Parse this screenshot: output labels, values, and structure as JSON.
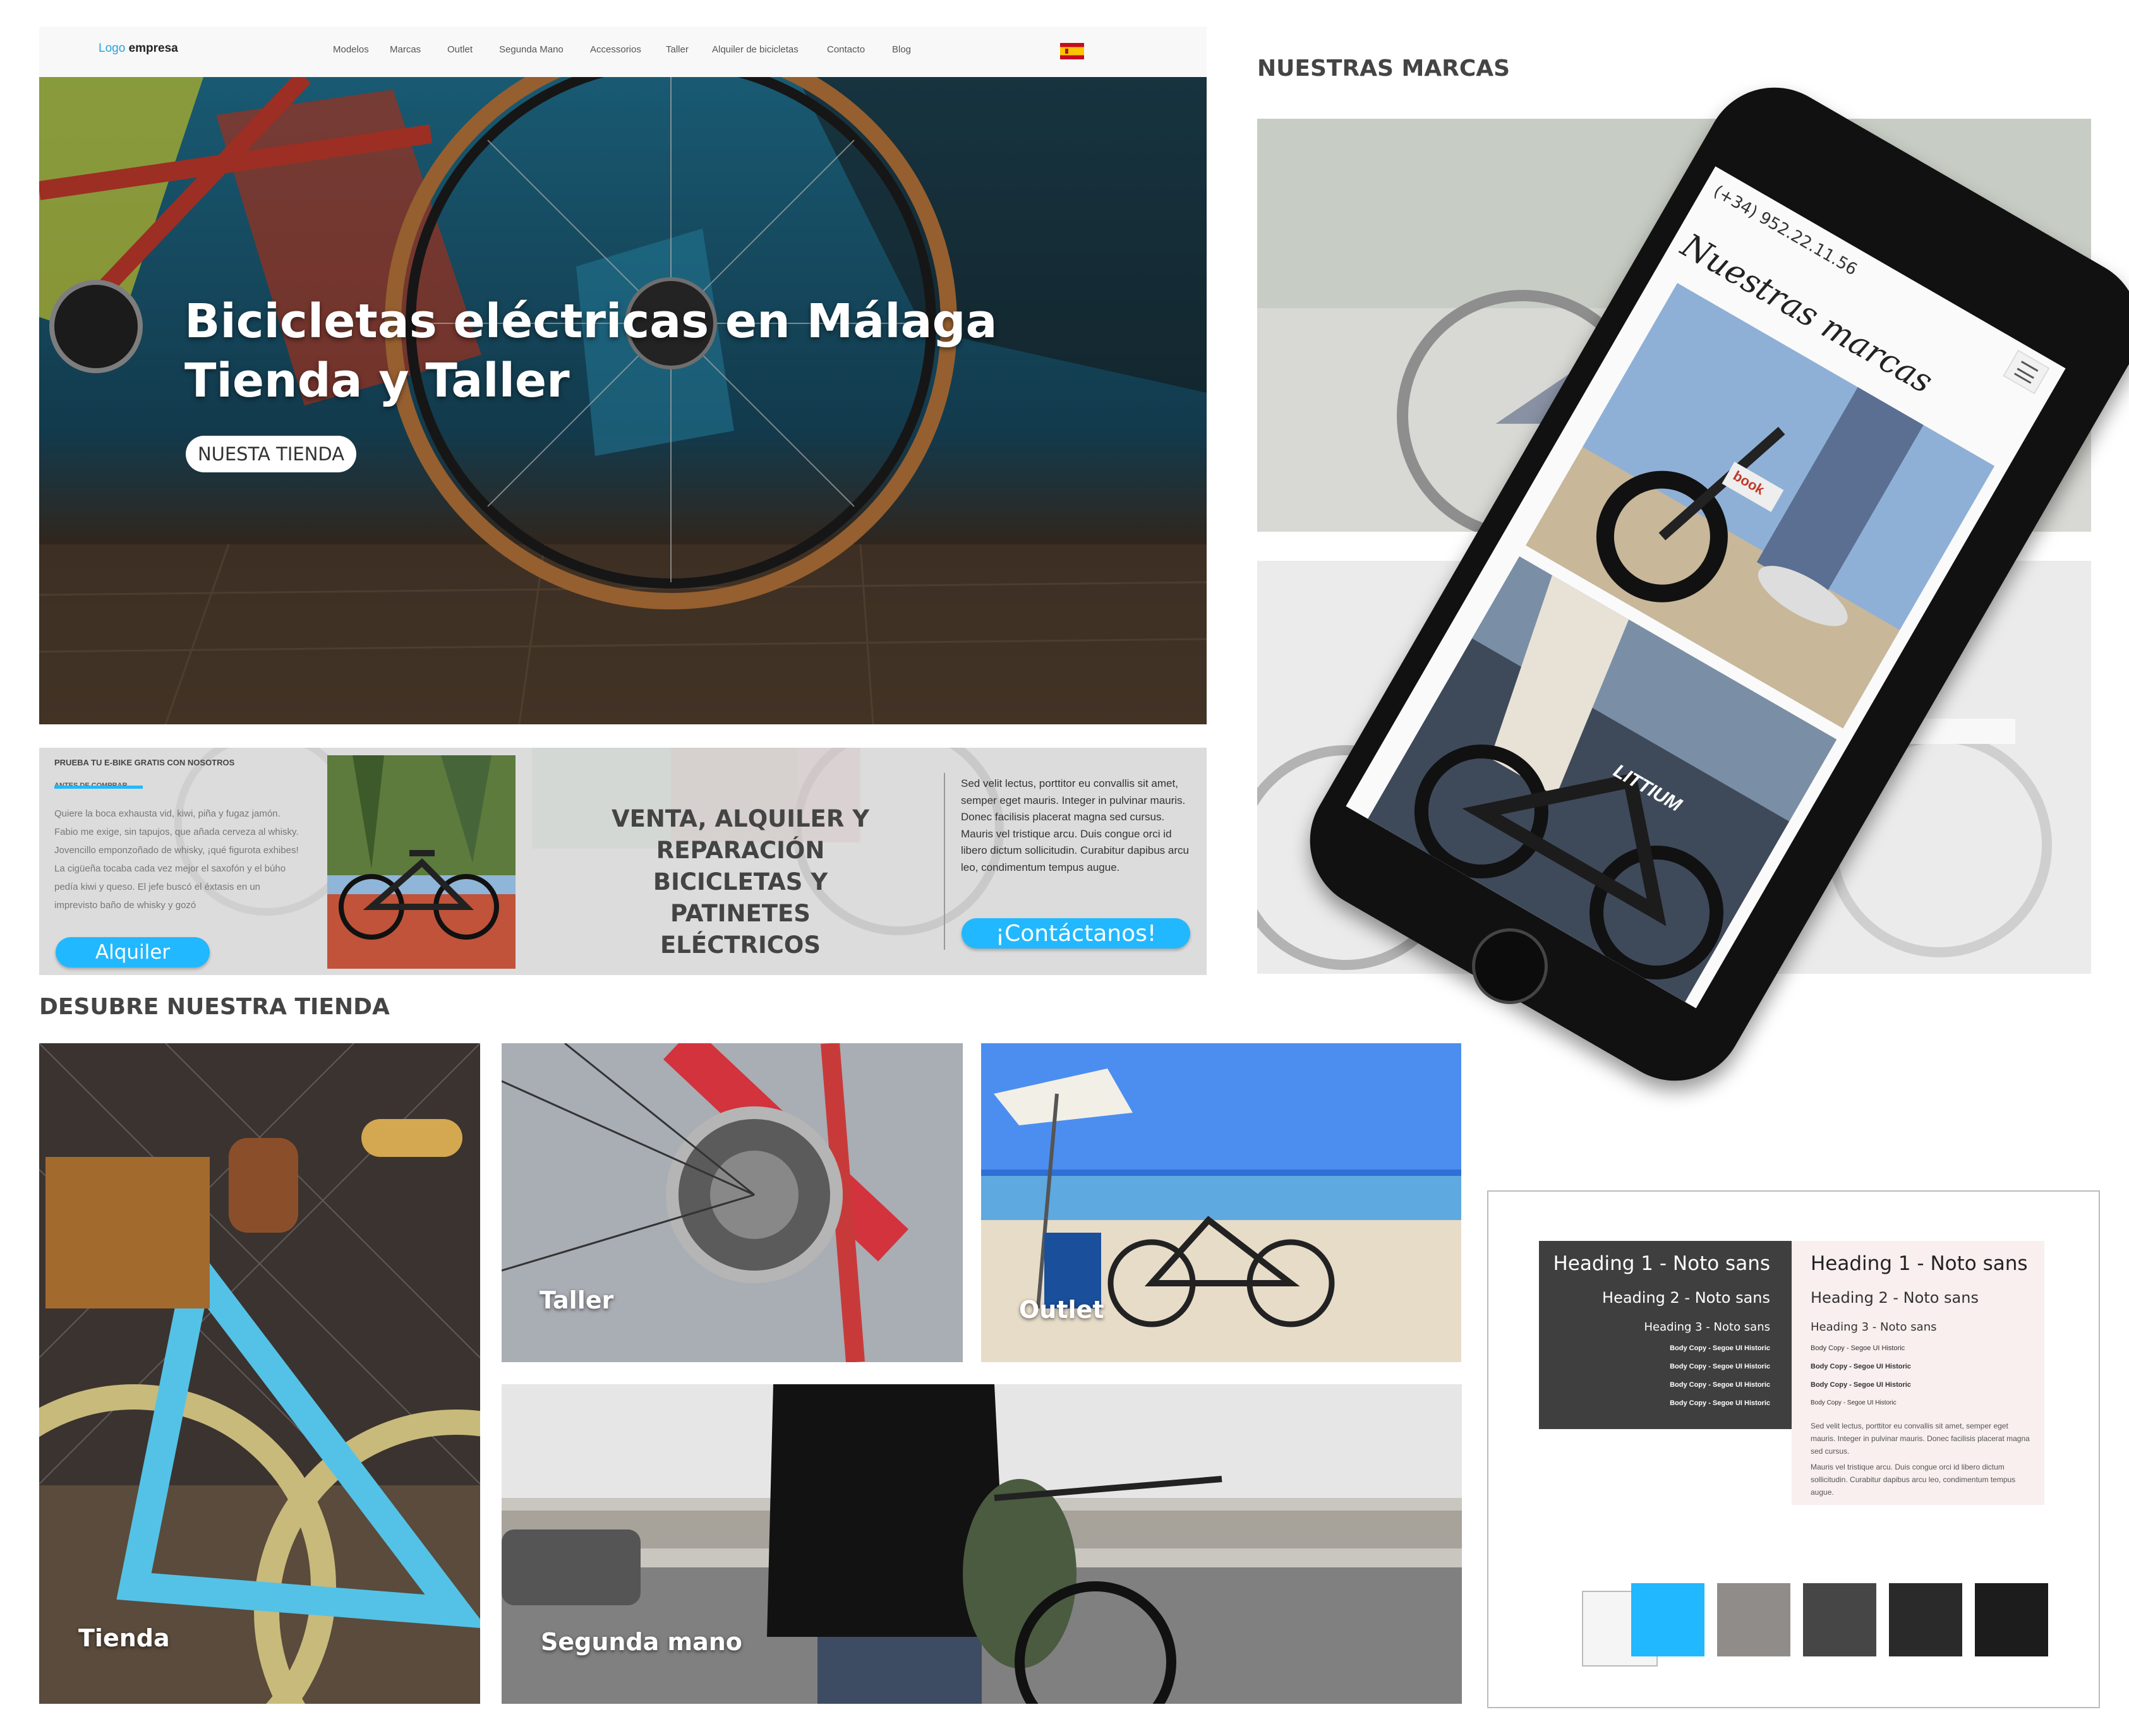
{
  "nav": {
    "logo_prefix": "Logo",
    "logo_name": "empresa",
    "items": [
      "Modelos",
      "Marcas",
      "Outlet",
      "Segunda Mano",
      "Accessorios",
      "Taller",
      "Alquiler de bicicletas",
      "Contacto",
      "Blog"
    ]
  },
  "hero": {
    "title_line1": "Bicicletas eléctricas en Málaga",
    "title_line2": "Tienda y Taller",
    "button": "NUESTA TIENDA"
  },
  "banner": {
    "kicker": "PRUEBA TU E-BIKE GRATIS CON NOSOTROS",
    "subkicker": "ANTES DE COMPRAR",
    "paragraph": "Quiere la boca exhausta vid, kiwi, piña y fugaz jamón. Fabio me exige, sin tapujos, que añada cerveza al whisky. Jovencillo emponzoñado de whisky, ¡qué figurota exhibes! La cigüeña tocaba cada vez mejor el saxofón y el búho pedía kiwi y queso. El jefe buscó el éxtasis en un imprevisto baño de whisky y gozó",
    "alquiler_button": "Alquiler",
    "middle_heading": "VENTA, ALQUILER Y REPARACIÓN BICICLETAS Y PATINETES ELÉCTRICOS",
    "right_text": "Sed velit lectus, porttitor eu convallis sit amet, semper eget mauris. Integer in pulvinar mauris. Donec facilisis placerat magna sed cursus. Mauris vel tristique arcu. Duis congue orci id libero dictum sollicitudin. Curabitur dapibus arcu leo, condimentum tempus augue.",
    "contact_button": "¡Contáctanos!"
  },
  "sections": {
    "brands_title": "NUESTRAS MARCAS",
    "store_title": "DESUBRE NUESTRA TIENDA"
  },
  "gallery": {
    "tienda": "Tienda",
    "taller": "Taller",
    "outlet": "Outlet",
    "segunda_mano": "Segunda mano"
  },
  "phone": {
    "phone_number": "(+34) 952.22.11.56",
    "title": "Nuestras marcas",
    "brand_mark": "LITTIUM",
    "bike_label": "book"
  },
  "style_guide": {
    "dark": {
      "h1": "Heading 1 - Noto sans",
      "h2": "Heading 2 - Noto sans",
      "h3": "Heading 3 - Noto sans",
      "body": [
        "Body Copy - Segoe UI Historic",
        "Body Copy - Segoe UI Historic",
        "Body Copy - Segoe UI Historic",
        "Body Copy - Segoe UI Historic"
      ]
    },
    "light": {
      "h1": "Heading 1 - Noto sans",
      "h2": "Heading 2 - Noto sans",
      "h3": "Heading 3 - Noto sans",
      "body": [
        "Body Copy - Segoe UI Historic",
        "Body Copy - Segoe UI Historic",
        "Body Copy - Segoe UI Historic",
        "Body Copy - Segoe UI Historic"
      ],
      "para1": "Sed velit lectus, porttitor eu convallis sit amet, semper eget mauris. Integer in pulvinar mauris. Donec facilisis placerat magna sed cursus.",
      "para2": "Mauris vel tristique arcu. Duis congue orci id libero dictum sollicitudin. Curabitur dapibus arcu leo, condimentum tempus augue."
    },
    "swatches": [
      "#f5f5f5",
      "#22b8ff",
      "#8f8c8a",
      "#464646",
      "#2a2a2a",
      "#1c1c1c"
    ]
  },
  "colors": {
    "accent": "#22b8ff",
    "logo_blue": "#2aa2d9",
    "dark_text": "#3a3a3a"
  }
}
